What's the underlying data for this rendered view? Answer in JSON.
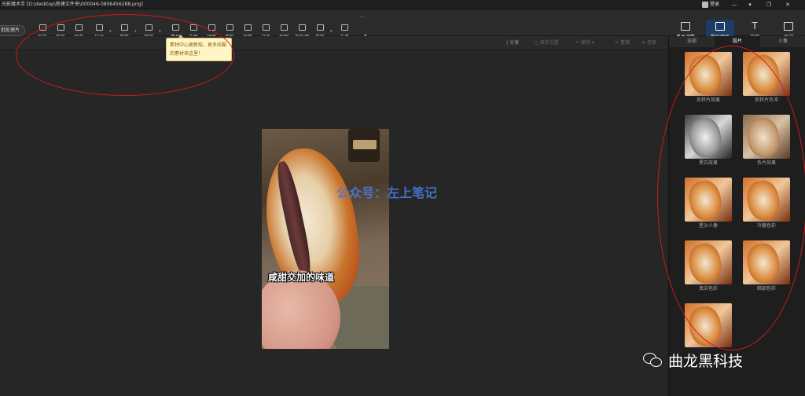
{
  "window": {
    "title": "光影魔术手 [D:\\desktop\\新建文件夹\\000046-0806456288.png]",
    "login_label": "登录",
    "controls": [
      "—",
      "▾",
      "❐",
      "✕"
    ]
  },
  "toolbar": {
    "batch_label": "批处理片",
    "tools": [
      {
        "label": "打开",
        "icon": "folder-icon"
      },
      {
        "label": "保存",
        "icon": "save-icon"
      },
      {
        "label": "另存",
        "icon": "save-as-icon"
      },
      {
        "label": "尺寸",
        "icon": "resize-icon"
      },
      {
        "label": "裁剪",
        "icon": "crop-icon"
      },
      {
        "label": "旋转",
        "icon": "rotate-icon"
      },
      {
        "label": "素材",
        "icon": "material-icon"
      },
      {
        "label": "边框",
        "icon": "frame-icon"
      },
      {
        "label": "拼图",
        "icon": "puzzle-icon"
      },
      {
        "label": "模板",
        "icon": "template-icon"
      },
      {
        "label": "画笔",
        "icon": "brush-icon"
      },
      {
        "label": "日历",
        "icon": "calendar-icon"
      },
      {
        "label": "抠图",
        "icon": "cutout-icon"
      },
      {
        "label": "批处理",
        "icon": "batch-icon"
      },
      {
        "label": "排版",
        "icon": "layout-icon"
      },
      {
        "label": "工具",
        "icon": "tool-icon"
      },
      {
        "label": "···",
        "icon": "more-icon"
      }
    ],
    "right_tools": [
      {
        "label": "基本调整",
        "icon": "adjust-icon"
      },
      {
        "label": "数码暗房",
        "icon": "darkroom-icon"
      },
      {
        "label": "文字",
        "icon": "text-icon"
      },
      {
        "label": "水印",
        "icon": "watermark-icon"
      }
    ]
  },
  "subbar": {
    "share": "分享",
    "save_settings": "保存设置",
    "undo": "撤销",
    "redo": "重做",
    "restore": "还原"
  },
  "tooltip": {
    "text": "素材中心更新啦，更多炫酷的素材来这里！"
  },
  "canvas": {
    "caption": "咸甜交加的味道",
    "watermark": "公众号：左上笔记"
  },
  "right_panel": {
    "tabs": [
      "全部",
      "胶片",
      "人像"
    ],
    "active_tab": 1,
    "effects": [
      {
        "label": "反转片效果",
        "tone": "warm"
      },
      {
        "label": "反转片负冲",
        "tone": "warm"
      },
      {
        "label": "黑白效果",
        "tone": "mono"
      },
      {
        "label": "负片效果",
        "tone": "fade"
      },
      {
        "label": "星沙人像",
        "tone": "warm"
      },
      {
        "label": "冷暖色彩",
        "tone": "warm"
      },
      {
        "label": "真实色彩",
        "tone": "warm"
      },
      {
        "label": "暗部色彩",
        "tone": "warm"
      },
      {
        "label": "",
        "tone": "warm"
      }
    ]
  },
  "footer_watermark": {
    "text": "曲龙黑科技"
  },
  "colors": {
    "annotation": "#d0181c",
    "accent": "#3a8ee6",
    "tooltip_bg": "#fff6c8"
  }
}
